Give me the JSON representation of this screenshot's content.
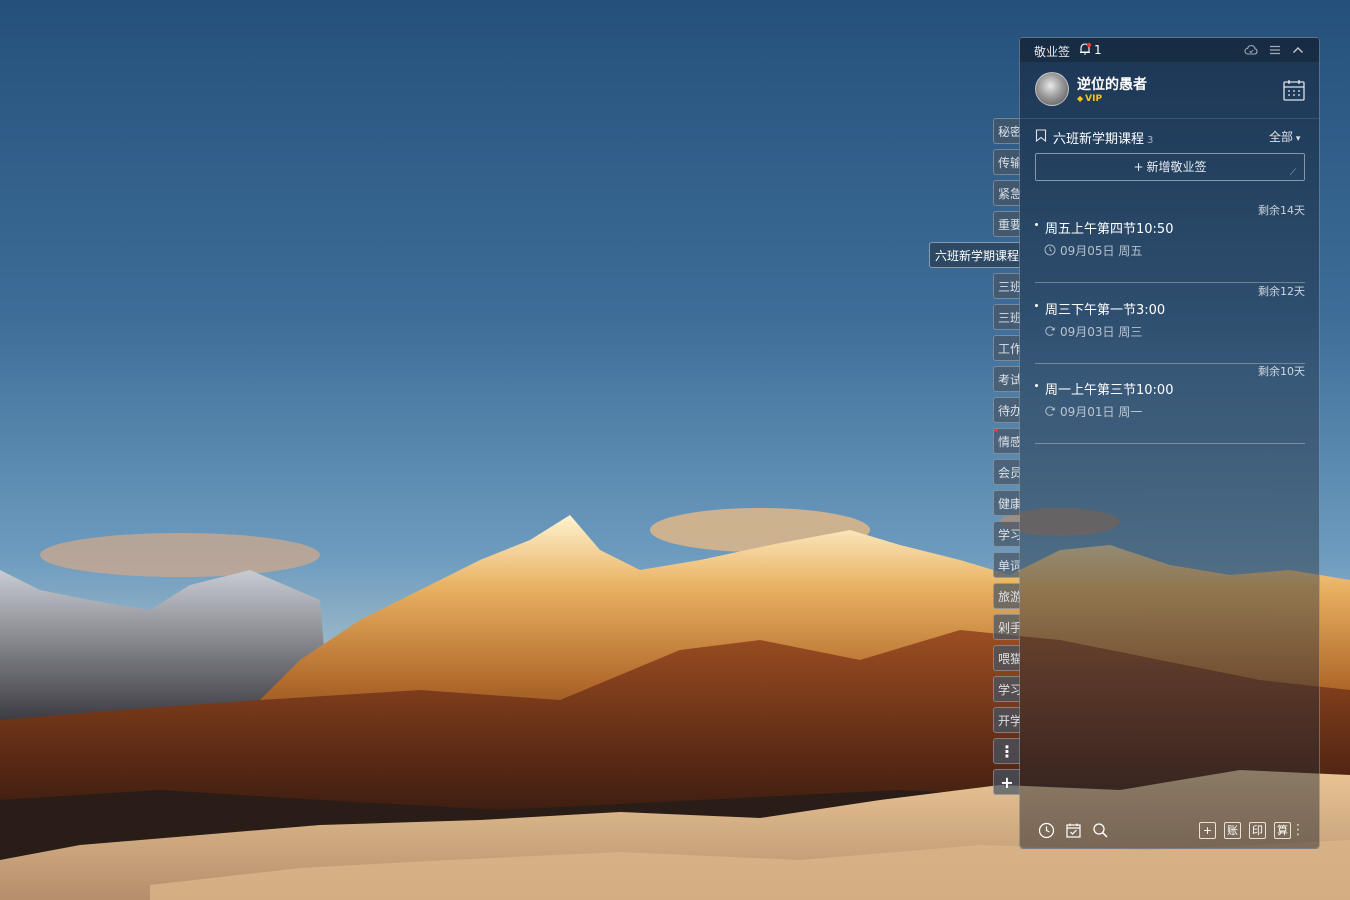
{
  "app": {
    "title": "敬业签",
    "notification_count": "1"
  },
  "user": {
    "name": "逆位的愚者",
    "badge": "VIP"
  },
  "list": {
    "title": "六班新学期课程",
    "count": "3",
    "filter": "全部",
    "add_label": "新增敬业签",
    "add_corner": "⟋"
  },
  "tasks": [
    {
      "remaining": "剩余14天",
      "title": "周五上午第四节10:50",
      "date": "09月05日 周五",
      "icon": "clock-icon"
    },
    {
      "remaining": "剩余12天",
      "title": "周三下午第一节3:00",
      "date": "09月03日 周三",
      "icon": "repeat-icon"
    },
    {
      "remaining": "剩余10天",
      "title": "周一上午第三节10:00",
      "date": "09月01日 周一",
      "icon": "repeat-icon"
    }
  ],
  "side_tabs": {
    "t0": "秘密",
    "t1": "传输",
    "t2": "紧急",
    "t3": "重要",
    "t4": "六班新学期课程",
    "t5": "三班",
    "t6": "三班",
    "t7": "工作",
    "t8": "考试",
    "t9": "待办",
    "t10": "情感",
    "t11": "会员",
    "t12": "健康",
    "t13": "学习",
    "t14": "单词",
    "t15": "旅游",
    "t16": "剁手",
    "t17": "喂猫",
    "t18": "学习",
    "t19": "开学",
    "more": "⋮",
    "add": "+"
  },
  "bottom_tools": {
    "add": "+",
    "ledger": "账",
    "print": "印",
    "calc": "算",
    "more": "⋮"
  },
  "colors": {
    "panel_bg": "#1f3550",
    "accent_vip": "#f5c518",
    "alert_red": "#e53935"
  }
}
